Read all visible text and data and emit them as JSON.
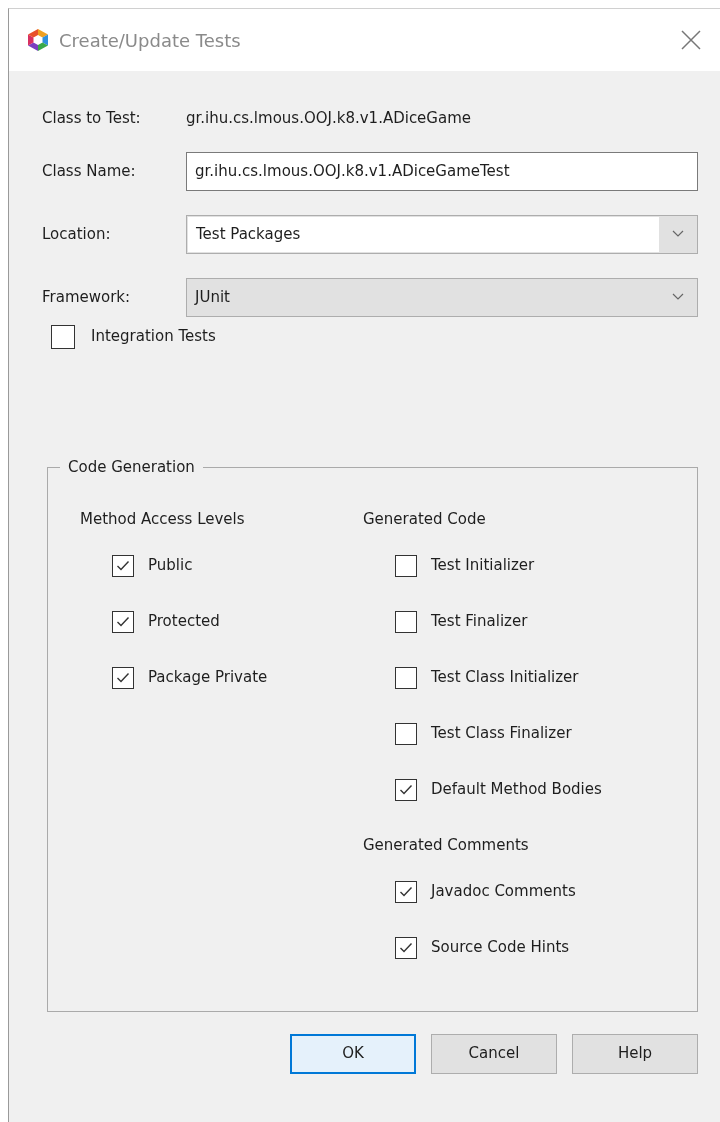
{
  "window": {
    "title": "Create/Update Tests"
  },
  "fields": [
    {
      "kind": "info",
      "label": "Class to Test:",
      "value": "gr.ihu.cs.lmous.OOJ.k8.v1.ADiceGame"
    },
    {
      "kind": "text",
      "label": "Class Name:",
      "value": "gr.ihu.cs.lmous.OOJ.k8.v1.ADiceGameTest"
    },
    {
      "kind": "combo",
      "label": "Location:",
      "value": "Test Packages"
    },
    {
      "kind": "select",
      "label": "Framework:",
      "value": "JUnit"
    }
  ],
  "integration": {
    "label": "Integration Tests",
    "checked": false
  },
  "code_generation": {
    "title": "Code Generation",
    "columns": [
      {
        "sections": [
          {
            "heading": "Method Access Levels",
            "options": [
              {
                "label": "Public",
                "checked": true
              },
              {
                "label": "Protected",
                "checked": true
              },
              {
                "label": "Package Private",
                "checked": true
              }
            ]
          }
        ]
      },
      {
        "sections": [
          {
            "heading": "Generated Code",
            "options": [
              {
                "label": "Test Initializer",
                "checked": false
              },
              {
                "label": "Test Finalizer",
                "checked": false
              },
              {
                "label": "Test Class Initializer",
                "checked": false
              },
              {
                "label": "Test Class Finalizer",
                "checked": false
              },
              {
                "label": "Default Method Bodies",
                "checked": true
              }
            ]
          },
          {
            "heading": "Generated Comments",
            "options": [
              {
                "label": "Javadoc Comments",
                "checked": true
              },
              {
                "label": "Source Code Hints",
                "checked": true
              }
            ]
          }
        ]
      }
    ]
  },
  "buttons": [
    {
      "label": "OK",
      "default": true
    },
    {
      "label": "Cancel",
      "default": false
    },
    {
      "label": "Help",
      "default": false
    }
  ]
}
